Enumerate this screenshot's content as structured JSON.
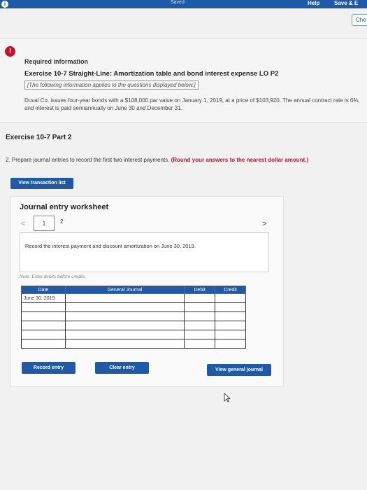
{
  "topbar": {
    "info_icon": "i",
    "saved": "Saved",
    "help": "Help",
    "save_exit": "Save & E"
  },
  "check_button": "Che",
  "required": {
    "alert_icon": "!",
    "title": "Required information",
    "exercise": "Exercise 10-7 Straight-Line: Amortization table and bond interest expense LO P2",
    "intro": "[The following information applies to the questions displayed below.]",
    "problem": "Duval Co. issues four-year bonds with a $108,000 par value on January 1, 2019, at a price of $103,920. The annual contract rate is 6%, and interest is paid semiannually on June 30 and December 31."
  },
  "part": {
    "title": "Exercise 10-7 Part 2",
    "instruction": "2. Prepare journal entries to record the first two interest payments.",
    "instruction_bold": "(Round your answers to the nearest dollar amount.)"
  },
  "buttons": {
    "view_transaction_list": "View transaction list",
    "record_entry": "Record entry",
    "clear_entry": "Clear entry",
    "view_general_journal": "View general journal"
  },
  "worksheet": {
    "title": "Journal entry worksheet",
    "nav_left": "<",
    "nav_right": ">",
    "tabs": [
      "1",
      "2"
    ],
    "prompt": "Record the interest payment and discount amortization on June 30, 2019.",
    "note": "Note: Enter debits before credits."
  },
  "journal": {
    "headers": [
      "Date",
      "General Journal",
      "Debit",
      "Credit"
    ],
    "rows": [
      [
        "June 30, 2019",
        "",
        "",
        ""
      ],
      [
        "",
        "",
        "",
        ""
      ],
      [
        "",
        "",
        "",
        ""
      ],
      [
        "",
        "",
        "",
        ""
      ],
      [
        "",
        "",
        "",
        ""
      ],
      [
        "",
        "",
        "",
        ""
      ]
    ]
  },
  "cursor_icon": "pointer-icon"
}
